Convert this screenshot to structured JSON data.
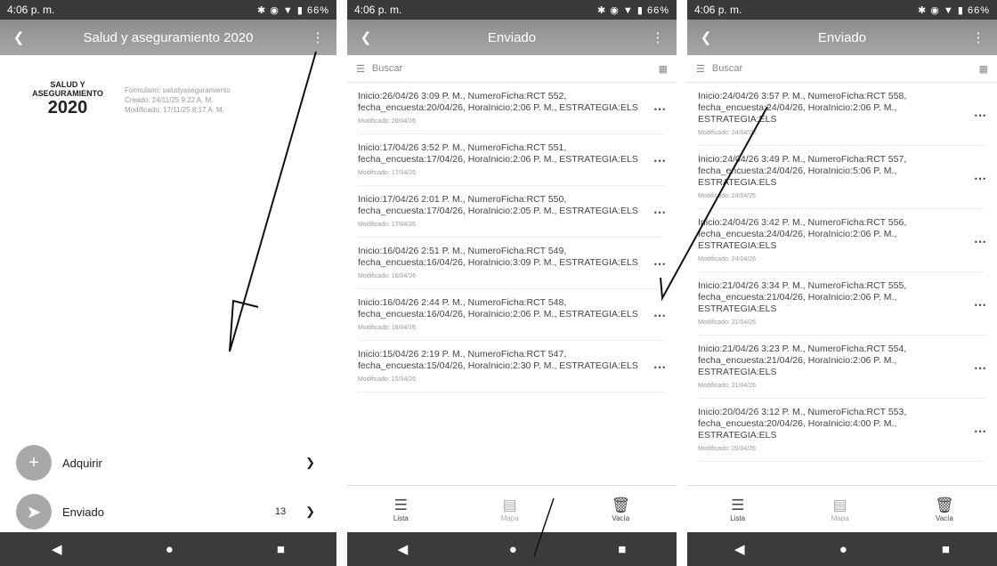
{
  "status_time": "4:06 p. m.",
  "status_icons": "✱ ◉ ▼ ▮ 66%",
  "icons": {
    "back": "chevron-left-icon",
    "menu": "kebab-icon",
    "more": "ellipsis-icon"
  },
  "panel1": {
    "title": "Salud y aseguramiento 2020",
    "logo_line1": "SALUD Y",
    "logo_line2": "ASEGURAMIENTO",
    "logo_year": "2020",
    "meta_line1": "Formulario: saludyaseguramiento",
    "meta_line2": "Creado: 24/11/25 9:22 A. M.",
    "meta_line3": "Modificado: 17/11/25 8:17 A. M.",
    "actions": [
      {
        "label": "Adquirir",
        "count": ""
      },
      {
        "label": "Enviado",
        "count": "13"
      }
    ]
  },
  "panel2": {
    "title": "Enviado",
    "search_placeholder": "Buscar",
    "items": [
      {
        "text": "Inicio:26/04/26 3:09 P. M., NumeroFicha:RCT 552, fecha_encuesta:20/04/26, HoraInicio:2:06 P. M., ESTRATEGIA:ELS",
        "sub": "Modificado: 26/04/26"
      },
      {
        "text": "Inicio:17/04/26 3:52 P. M., NumeroFicha:RCT 551, fecha_encuesta:17/04/26, HoraInicio:2:06 P. M., ESTRATEGIA:ELS",
        "sub": "Modificado: 17/04/26"
      },
      {
        "text": "Inicio:17/04/26 2:01 P. M., NumeroFicha:RCT 550, fecha_encuesta:17/04/26, HoraInicio:2:05 P. M., ESTRATEGIA:ELS",
        "sub": "Modificado: 17/04/26"
      },
      {
        "text": "Inicio:16/04/26 2:51 P. M., NumeroFicha:RCT 549, fecha_encuesta:16/04/26, HoraInicio:3:09 P. M., ESTRATEGIA:ELS",
        "sub": "Modificado: 16/04/26"
      },
      {
        "text": "Inicio:16/04/26 2:44 P. M., NumeroFicha:RCT 548, fecha_encuesta:16/04/26, HoraInicio:2:06 P. M., ESTRATEGIA:ELS",
        "sub": "Modificado: 16/04/26"
      },
      {
        "text": "Inicio:15/04/26 2:19 P. M., NumeroFicha:RCT 547, fecha_encuesta:15/04/26, HoraInicio:2:30 P. M., ESTRATEGIA:ELS",
        "sub": "Modificado: 15/04/26"
      }
    ],
    "bottom": [
      {
        "label": "Lista"
      },
      {
        "label": "Mapa"
      },
      {
        "label": "Vacía"
      }
    ]
  },
  "panel3": {
    "title": "Enviado",
    "search_placeholder": "Buscar",
    "items": [
      {
        "text": "Inicio:24/04/26 3:57 P. M., NumeroFicha:RCT 558, fecha_encuesta:24/04/26, HoraInicio:2:06 P. M., ESTRATEGIA:ELS",
        "sub": "Modificado: 24/04/26"
      },
      {
        "text": "Inicio:24/04/26 3:49 P. M., NumeroFicha:RCT 557, fecha_encuesta:24/04/26, HoraInicio:5:06 P. M., ESTRATEGIA:ELS",
        "sub": "Modificado: 24/04/26"
      },
      {
        "text": "Inicio:24/04/26 3:42 P. M., NumeroFicha:RCT 556, fecha_encuesta:24/04/26, HoraInicio:2:06 P. M., ESTRATEGIA:ELS",
        "sub": "Modificado: 24/04/26"
      },
      {
        "text": "Inicio:21/04/26 3:34 P. M., NumeroFicha:RCT 555, fecha_encuesta:21/04/26, HoraInicio:2:06 P. M., ESTRATEGIA:ELS",
        "sub": "Modificado: 21/04/26"
      },
      {
        "text": "Inicio:21/04/26 3:23 P. M., NumeroFicha:RCT 554, fecha_encuesta:21/04/26, HoraInicio:2:06 P. M., ESTRATEGIA:ELS",
        "sub": "Modificado: 21/04/26"
      },
      {
        "text": "Inicio:20/04/26 3:12 P. M., NumeroFicha:RCT 553, fecha_encuesta:20/04/26, HoraInicio:4:00 P. M., ESTRATEGIA:ELS",
        "sub": "Modificado: 20/04/26"
      }
    ],
    "bottom": [
      {
        "label": "Lista"
      },
      {
        "label": "Mapa"
      },
      {
        "label": "Vacía"
      }
    ]
  }
}
